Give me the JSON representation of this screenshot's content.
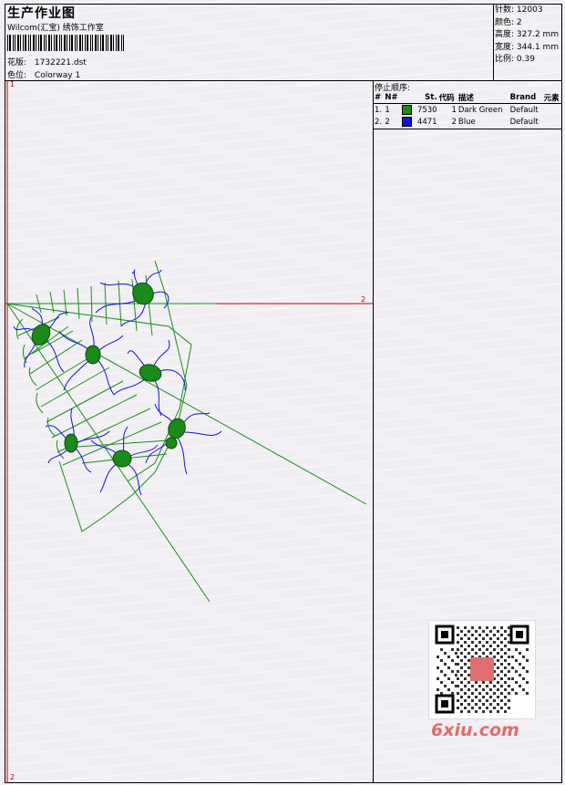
{
  "header": {
    "title": "生产作业图",
    "studio": "Wilcom(汇宝) 绣饰工作室",
    "design_label": "花版:",
    "design_file": "1732221.dst",
    "colorway_label": "色位:",
    "colorway": "Colorway 1"
  },
  "stats": {
    "stitches_label": "针数:",
    "stitches": "12003",
    "colors_label": "颜色:",
    "colors": "2",
    "height_label": "高度:",
    "height": "327.2 mm",
    "width_label": "宽度:",
    "width": "344.1 mm",
    "scale_label": "比例:",
    "scale": "0.39"
  },
  "stop_sequence": {
    "title": "停止顺序:",
    "columns": [
      "#",
      "N#",
      "St.",
      "代码",
      "描述",
      "Brand",
      "元素"
    ],
    "rows": [
      {
        "num": "1.",
        "n": "1",
        "color": "#1a8a1a",
        "stitches": "7530",
        "code": "1",
        "desc": "Dark Green",
        "brand": "Default"
      },
      {
        "num": "2.",
        "n": "2",
        "color": "#1010e0",
        "stitches": "4471",
        "code": "2",
        "desc": "Blue",
        "brand": "Default"
      }
    ]
  },
  "markers": {
    "top_left": "1",
    "right": "2",
    "bottom_left": "2"
  },
  "watermark": "6xiu.com",
  "colors": {
    "green": "#1a8a1a",
    "blue": "#1010e0",
    "axis_red": "#c00000"
  }
}
